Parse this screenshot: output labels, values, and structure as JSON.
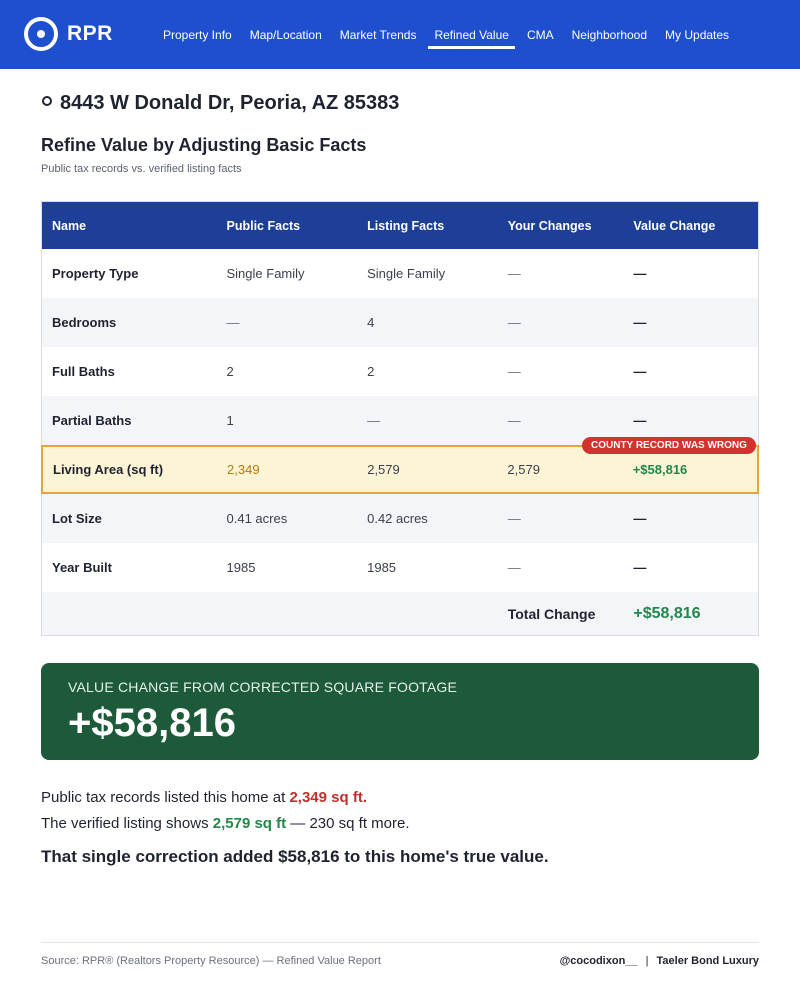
{
  "brand": {
    "logo_text": "RPR"
  },
  "nav": [
    "Property Info",
    "Map/Location",
    "Market Trends",
    "Refined Value",
    "CMA",
    "Neighborhood",
    "My Updates"
  ],
  "nav_active": "Refined Value",
  "address": "8443 W Donald Dr, Peoria, AZ 85383",
  "section": {
    "title": "Refine Value by Adjusting Basic Facts",
    "subtitle": "Public tax records vs. verified listing facts"
  },
  "table": {
    "headers": [
      "Name",
      "Public Facts",
      "Listing Facts",
      "Your Changes",
      "Value Change"
    ],
    "rows": [
      {
        "name": "Property Type",
        "public": "Single Family",
        "listing": "Single Family",
        "changes": "—",
        "value": "—"
      },
      {
        "name": "Bedrooms",
        "public": "—",
        "listing": "4",
        "changes": "—",
        "value": "—"
      },
      {
        "name": "Full Baths",
        "public": "2",
        "listing": "2",
        "changes": "—",
        "value": "—"
      },
      {
        "name": "Partial Baths",
        "public": "1",
        "listing": "—",
        "changes": "—",
        "value": "—"
      },
      {
        "name": "Living Area (sq ft)",
        "public": "2,349",
        "listing": "2,579",
        "changes": "2,579",
        "value": "+$58,816",
        "tag": "COUNTY RECORD WAS WRONG"
      },
      {
        "name": "Lot Size",
        "public": "0.41 acres",
        "listing": "0.42 acres",
        "changes": "—",
        "value": "—"
      },
      {
        "name": "Year Built",
        "public": "1985",
        "listing": "1985",
        "changes": "—",
        "value": "—"
      }
    ],
    "total_label": "Total Change",
    "total_value": "+$58,816"
  },
  "callout": {
    "label": "VALUE CHANGE FROM CORRECTED SQUARE FOOTAGE",
    "value": "+$58,816"
  },
  "body": {
    "line1_prefix": "Public tax records listed this home at",
    "line1_value": "2,349 sq ft.",
    "line2_prefix": "The verified listing shows",
    "line2_value": "2,579 sq ft",
    "line2_suffix": "— 230 sq ft more.",
    "conclusion": "That single correction added $58,816 to this home's true value."
  },
  "footer": {
    "source": "Source: RPR® (Realtors Property Resource) — Refined Value Report",
    "handle": "@cocodixon__",
    "separator": "|",
    "brokerage": "Taeler Bond Luxury"
  },
  "colors": {
    "nav_bg": "#1d4fcf",
    "table_header_bg": "#1e3f98",
    "highlight_bg": "#fdf3d5",
    "highlight_border": "#e3a63a",
    "positive_green": "#23864a",
    "alert_red": "#d4322e",
    "callout_bg": "#1c5a3a"
  }
}
